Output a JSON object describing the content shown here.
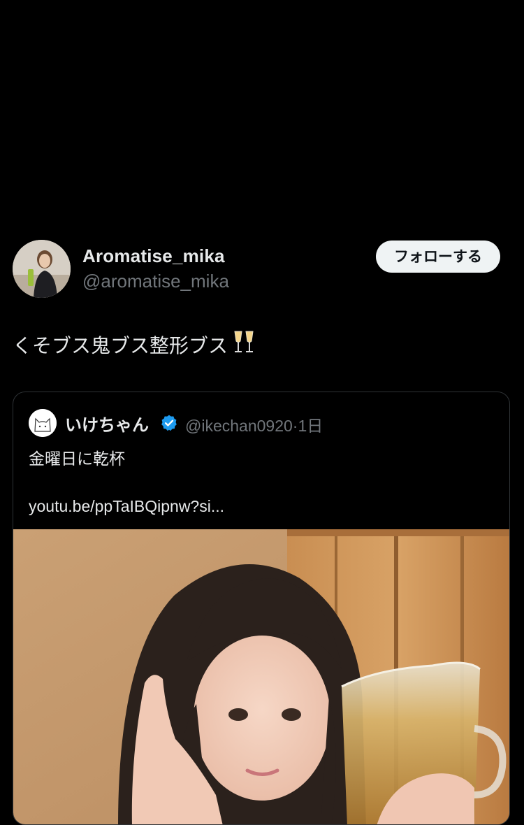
{
  "author": {
    "display_name": "Aromatise_mika",
    "handle": "@aromatise_mika",
    "avatar_icon": "profile-photo"
  },
  "follow_button": {
    "label": "フォローする"
  },
  "tweet": {
    "text": "くそブス鬼ブス整形ブス",
    "emoji_icon": "clinking-glasses-icon"
  },
  "quoted_tweet": {
    "display_name": "いけちゃん",
    "verified_icon": "verified-badge-icon",
    "handle": "@ikechan0920",
    "separator": "·",
    "time": "1日",
    "text": "金曜日に乾杯",
    "link": "youtu.be/ppTaIBQipnw?si...",
    "media_icon": "photo-image"
  },
  "colors": {
    "background": "#000000",
    "text_primary": "#e7e9ea",
    "text_secondary": "#71767b",
    "verified_blue": "#1d9bf0",
    "button_bg": "#eff3f4"
  }
}
